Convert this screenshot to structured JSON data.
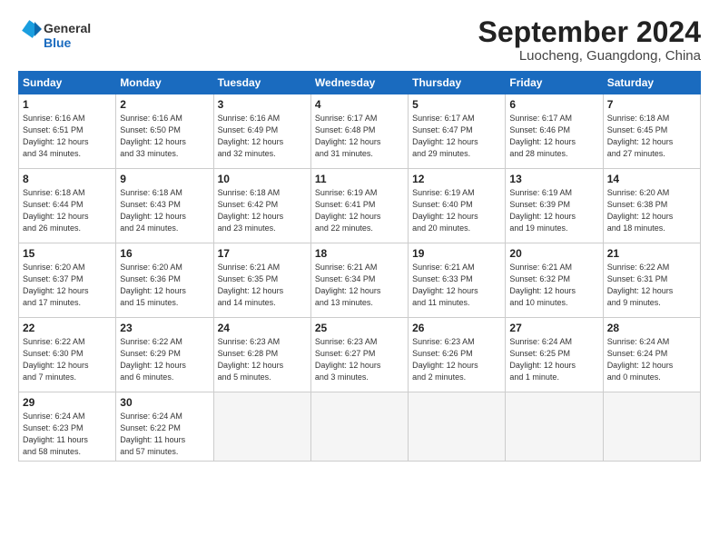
{
  "header": {
    "logo_line1": "General",
    "logo_line2": "Blue",
    "month_title": "September 2024",
    "location": "Luocheng, Guangdong, China"
  },
  "days_of_week": [
    "Sunday",
    "Monday",
    "Tuesday",
    "Wednesday",
    "Thursday",
    "Friday",
    "Saturday"
  ],
  "weeks": [
    [
      {
        "day": "1",
        "info": "Sunrise: 6:16 AM\nSunset: 6:51 PM\nDaylight: 12 hours\nand 34 minutes."
      },
      {
        "day": "2",
        "info": "Sunrise: 6:16 AM\nSunset: 6:50 PM\nDaylight: 12 hours\nand 33 minutes."
      },
      {
        "day": "3",
        "info": "Sunrise: 6:16 AM\nSunset: 6:49 PM\nDaylight: 12 hours\nand 32 minutes."
      },
      {
        "day": "4",
        "info": "Sunrise: 6:17 AM\nSunset: 6:48 PM\nDaylight: 12 hours\nand 31 minutes."
      },
      {
        "day": "5",
        "info": "Sunrise: 6:17 AM\nSunset: 6:47 PM\nDaylight: 12 hours\nand 29 minutes."
      },
      {
        "day": "6",
        "info": "Sunrise: 6:17 AM\nSunset: 6:46 PM\nDaylight: 12 hours\nand 28 minutes."
      },
      {
        "day": "7",
        "info": "Sunrise: 6:18 AM\nSunset: 6:45 PM\nDaylight: 12 hours\nand 27 minutes."
      }
    ],
    [
      {
        "day": "8",
        "info": "Sunrise: 6:18 AM\nSunset: 6:44 PM\nDaylight: 12 hours\nand 26 minutes."
      },
      {
        "day": "9",
        "info": "Sunrise: 6:18 AM\nSunset: 6:43 PM\nDaylight: 12 hours\nand 24 minutes."
      },
      {
        "day": "10",
        "info": "Sunrise: 6:18 AM\nSunset: 6:42 PM\nDaylight: 12 hours\nand 23 minutes."
      },
      {
        "day": "11",
        "info": "Sunrise: 6:19 AM\nSunset: 6:41 PM\nDaylight: 12 hours\nand 22 minutes."
      },
      {
        "day": "12",
        "info": "Sunrise: 6:19 AM\nSunset: 6:40 PM\nDaylight: 12 hours\nand 20 minutes."
      },
      {
        "day": "13",
        "info": "Sunrise: 6:19 AM\nSunset: 6:39 PM\nDaylight: 12 hours\nand 19 minutes."
      },
      {
        "day": "14",
        "info": "Sunrise: 6:20 AM\nSunset: 6:38 PM\nDaylight: 12 hours\nand 18 minutes."
      }
    ],
    [
      {
        "day": "15",
        "info": "Sunrise: 6:20 AM\nSunset: 6:37 PM\nDaylight: 12 hours\nand 17 minutes."
      },
      {
        "day": "16",
        "info": "Sunrise: 6:20 AM\nSunset: 6:36 PM\nDaylight: 12 hours\nand 15 minutes."
      },
      {
        "day": "17",
        "info": "Sunrise: 6:21 AM\nSunset: 6:35 PM\nDaylight: 12 hours\nand 14 minutes."
      },
      {
        "day": "18",
        "info": "Sunrise: 6:21 AM\nSunset: 6:34 PM\nDaylight: 12 hours\nand 13 minutes."
      },
      {
        "day": "19",
        "info": "Sunrise: 6:21 AM\nSunset: 6:33 PM\nDaylight: 12 hours\nand 11 minutes."
      },
      {
        "day": "20",
        "info": "Sunrise: 6:21 AM\nSunset: 6:32 PM\nDaylight: 12 hours\nand 10 minutes."
      },
      {
        "day": "21",
        "info": "Sunrise: 6:22 AM\nSunset: 6:31 PM\nDaylight: 12 hours\nand 9 minutes."
      }
    ],
    [
      {
        "day": "22",
        "info": "Sunrise: 6:22 AM\nSunset: 6:30 PM\nDaylight: 12 hours\nand 7 minutes."
      },
      {
        "day": "23",
        "info": "Sunrise: 6:22 AM\nSunset: 6:29 PM\nDaylight: 12 hours\nand 6 minutes."
      },
      {
        "day": "24",
        "info": "Sunrise: 6:23 AM\nSunset: 6:28 PM\nDaylight: 12 hours\nand 5 minutes."
      },
      {
        "day": "25",
        "info": "Sunrise: 6:23 AM\nSunset: 6:27 PM\nDaylight: 12 hours\nand 3 minutes."
      },
      {
        "day": "26",
        "info": "Sunrise: 6:23 AM\nSunset: 6:26 PM\nDaylight: 12 hours\nand 2 minutes."
      },
      {
        "day": "27",
        "info": "Sunrise: 6:24 AM\nSunset: 6:25 PM\nDaylight: 12 hours\nand 1 minute."
      },
      {
        "day": "28",
        "info": "Sunrise: 6:24 AM\nSunset: 6:24 PM\nDaylight: 12 hours\nand 0 minutes."
      }
    ],
    [
      {
        "day": "29",
        "info": "Sunrise: 6:24 AM\nSunset: 6:23 PM\nDaylight: 11 hours\nand 58 minutes."
      },
      {
        "day": "30",
        "info": "Sunrise: 6:24 AM\nSunset: 6:22 PM\nDaylight: 11 hours\nand 57 minutes."
      },
      {
        "day": "",
        "info": ""
      },
      {
        "day": "",
        "info": ""
      },
      {
        "day": "",
        "info": ""
      },
      {
        "day": "",
        "info": ""
      },
      {
        "day": "",
        "info": ""
      }
    ]
  ]
}
